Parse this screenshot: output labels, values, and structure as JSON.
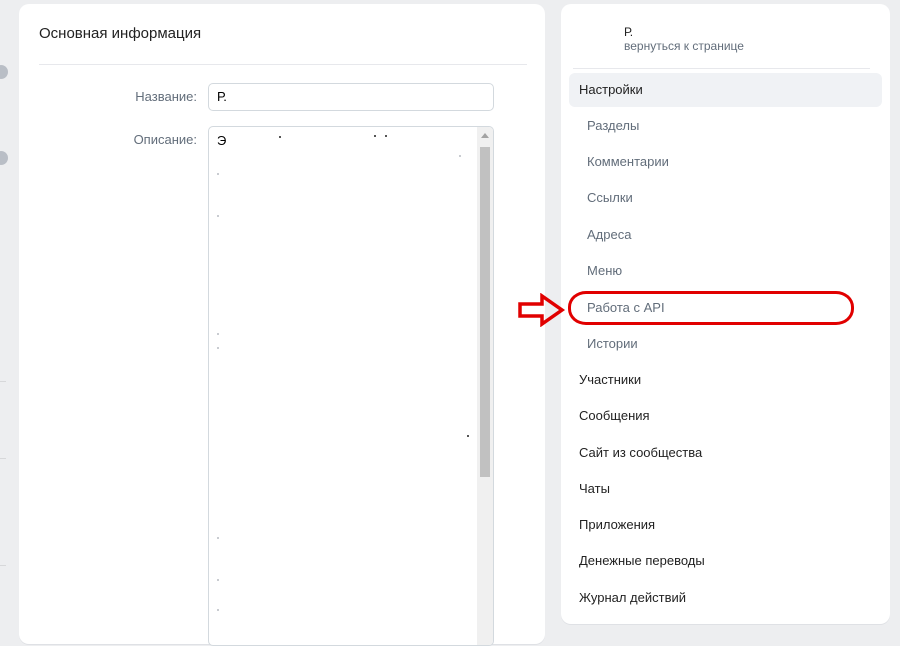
{
  "main": {
    "title": "Основная информация",
    "name_label": "Название:",
    "name_value": "Р.",
    "description_label": "Описание:",
    "description_value": "Э"
  },
  "side": {
    "group_name": "Р.",
    "back_link": "вернуться к странице",
    "menu": [
      {
        "label": "Настройки",
        "level": "top",
        "active": true
      },
      {
        "label": "Разделы",
        "level": "sub"
      },
      {
        "label": "Комментарии",
        "level": "sub"
      },
      {
        "label": "Ссылки",
        "level": "sub"
      },
      {
        "label": "Адреса",
        "level": "sub"
      },
      {
        "label": "Меню",
        "level": "sub"
      },
      {
        "label": "Работа с API",
        "level": "sub",
        "highlighted": true
      },
      {
        "label": "Истории",
        "level": "sub"
      },
      {
        "label": "Участники",
        "level": "top"
      },
      {
        "label": "Сообщения",
        "level": "top"
      },
      {
        "label": "Сайт из сообщества",
        "level": "top"
      },
      {
        "label": "Чаты",
        "level": "top"
      },
      {
        "label": "Приложения",
        "level": "top"
      },
      {
        "label": "Денежные переводы",
        "level": "top"
      },
      {
        "label": "Журнал действий",
        "level": "top"
      }
    ]
  },
  "annotation": {
    "color": "#e10000",
    "arrow_icon": "arrow-right-outline-icon"
  }
}
